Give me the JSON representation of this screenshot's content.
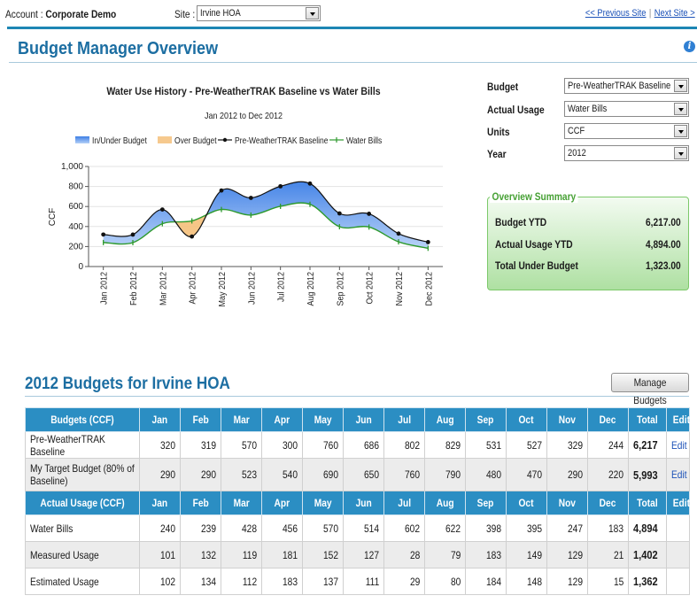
{
  "header": {
    "account_label": "Account : ",
    "account_name": "Corporate Demo",
    "site_label": "Site : ",
    "site_value": "Irvine HOA",
    "prev_site": "<< Previous Site",
    "next_site": "Next Site >"
  },
  "page_title": "Budget Manager Overview",
  "filters": {
    "budget": {
      "label": "Budget",
      "value": "Pre-WeatherTRAK Baseline"
    },
    "actual_usage": {
      "label": "Actual Usage",
      "value": "Water Bills"
    },
    "units": {
      "label": "Units",
      "value": "CCF"
    },
    "year": {
      "label": "Year",
      "value": "2012"
    }
  },
  "summary": {
    "title": "Overview Summary",
    "rows": [
      {
        "label": "Budget YTD",
        "value": "6,217.00"
      },
      {
        "label": "Actual Usage YTD",
        "value": "4,894.00"
      },
      {
        "label": "Total Under Budget",
        "value": "1,323.00"
      }
    ]
  },
  "chart_data": {
    "type": "line",
    "title": "Water Use History - Pre-WeatherTRAK Baseline vs Water Bills",
    "subtitle": "Jan 2012 to Dec 2012",
    "ylabel": "CCF",
    "xlabel": "",
    "ylim": [
      0,
      1000
    ],
    "yticks": [
      "1,000",
      "800",
      "600",
      "400",
      "200",
      "0"
    ],
    "categories": [
      "Jan 2012",
      "Feb 2012",
      "Mar 2012",
      "Apr 2012",
      "May 2012",
      "Jun 2012",
      "Jul 2012",
      "Aug 2012",
      "Sep 2012",
      "Oct 2012",
      "Nov 2012",
      "Dec 2012"
    ],
    "legend": [
      "In/Under Budget",
      "Over Budget",
      "Pre-WeatherTRAK Baseline",
      "Water Bills"
    ],
    "legend_position": "top",
    "series": [
      {
        "name": "Pre-WeatherTRAK Baseline",
        "values": [
          320,
          319,
          570,
          300,
          760,
          686,
          802,
          829,
          531,
          527,
          329,
          244
        ],
        "color": "#111111"
      },
      {
        "name": "Water Bills",
        "values": [
          240,
          239,
          428,
          456,
          570,
          514,
          602,
          622,
          398,
          395,
          247,
          183
        ],
        "color": "#2e9a2e"
      }
    ],
    "colors": {
      "under": "#4f8ff0",
      "over": "#f5c07a"
    },
    "grid": true
  },
  "budgets": {
    "title": "2012 Budgets for Irvine HOA",
    "manage_button": "Manage Budgets",
    "months": [
      "Jan",
      "Feb",
      "Mar",
      "Apr",
      "May",
      "Jun",
      "Jul",
      "Aug",
      "Sep",
      "Oct",
      "Nov",
      "Dec"
    ],
    "total_label": "Total",
    "edit_label": "Edit",
    "budget_header": "Budgets (CCF)",
    "budget_rows": [
      {
        "name": "Pre-WeatherTRAK Baseline",
        "values": [
          "320",
          "319",
          "570",
          "300",
          "760",
          "686",
          "802",
          "829",
          "531",
          "527",
          "329",
          "244"
        ],
        "total": "6,217",
        "edit": "Edit"
      },
      {
        "name": "My Target Budget (80% of Baseline)",
        "values": [
          "290",
          "290",
          "523",
          "540",
          "690",
          "650",
          "760",
          "790",
          "480",
          "470",
          "290",
          "220"
        ],
        "total": "5,993",
        "edit": "Edit"
      }
    ],
    "actual_header": "Actual Usage (CCF)",
    "actual_rows": [
      {
        "name": "Water Bills",
        "values": [
          "240",
          "239",
          "428",
          "456",
          "570",
          "514",
          "602",
          "622",
          "398",
          "395",
          "247",
          "183"
        ],
        "total": "4,894"
      },
      {
        "name": "Measured Usage",
        "values": [
          "101",
          "132",
          "119",
          "181",
          "152",
          "127",
          "28",
          "79",
          "183",
          "149",
          "129",
          "21"
        ],
        "total": "1,402"
      },
      {
        "name": "Estimated Usage",
        "values": [
          "102",
          "134",
          "112",
          "183",
          "137",
          "111",
          "29",
          "80",
          "184",
          "148",
          "129",
          "15"
        ],
        "total": "1,362"
      }
    ]
  }
}
